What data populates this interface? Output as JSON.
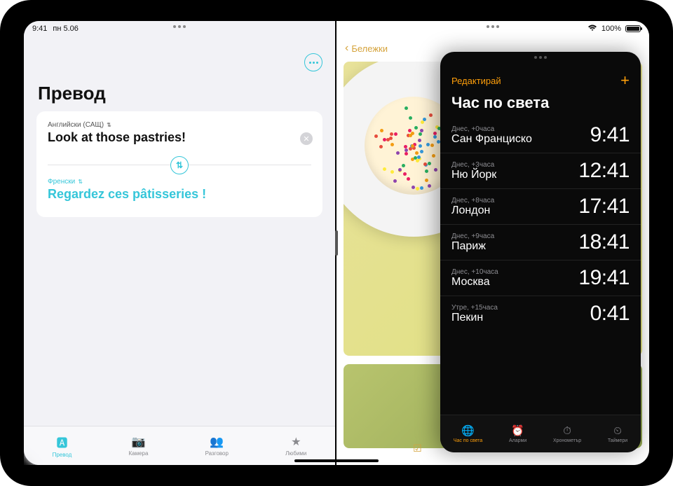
{
  "status": {
    "time": "9:41",
    "date": "пн 5.06",
    "battery": "100%"
  },
  "translate": {
    "title": "Превод",
    "source_lang": "Английски (САЩ)",
    "source_text": "Look at those pastries!",
    "target_lang": "Френски",
    "target_text": "Regardez ces pâtisseries !",
    "tabs": [
      {
        "label": "Превод"
      },
      {
        "label": "Камера"
      },
      {
        "label": "Разговор"
      },
      {
        "label": "Любими"
      }
    ]
  },
  "notes": {
    "back_label": "Бележки"
  },
  "clock": {
    "edit": "Редактирай",
    "title": "Час по света",
    "rows": [
      {
        "offset": "Днес, +0часа",
        "city": "Сан Франциско",
        "time": "9:41"
      },
      {
        "offset": "Днес, +3часа",
        "city": "Ню Йорк",
        "time": "12:41"
      },
      {
        "offset": "Днес, +8часа",
        "city": "Лондон",
        "time": "17:41"
      },
      {
        "offset": "Днес, +9часа",
        "city": "Париж",
        "time": "18:41"
      },
      {
        "offset": "Днес, +10часа",
        "city": "Москва",
        "time": "19:41"
      },
      {
        "offset": "Утре, +15часа",
        "city": "Пекин",
        "time": "0:41"
      }
    ],
    "tabs": [
      {
        "label": "Час по света"
      },
      {
        "label": "Аларми"
      },
      {
        "label": "Хронометър"
      },
      {
        "label": "Таймери"
      }
    ]
  }
}
